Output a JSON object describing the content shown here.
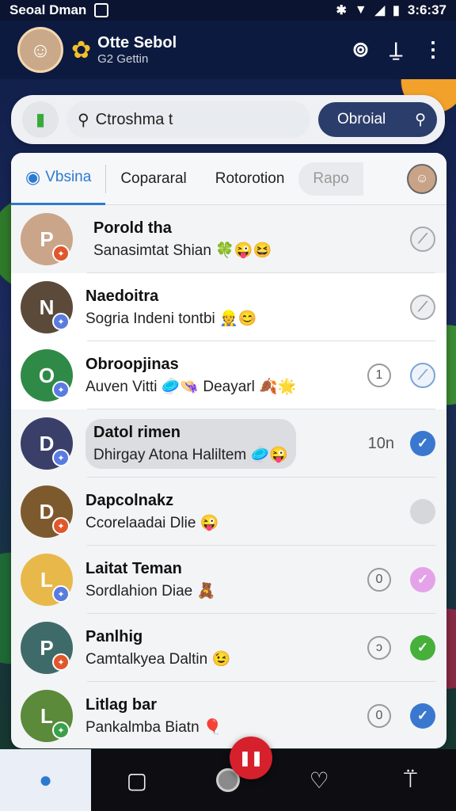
{
  "status_bar": {
    "left_text": "Seoal Dman",
    "time": "3:6:37"
  },
  "app_bar": {
    "title": "Otte Sebol",
    "subtitle": "G2 Gettin",
    "icons": [
      "search-icon",
      "user-pin-icon",
      "more-vert-icon"
    ]
  },
  "search": {
    "value": "Ctroshma t",
    "button_label": "Obroial"
  },
  "tabs": [
    {
      "label": "Vbsina",
      "active": true
    },
    {
      "label": "Copararal",
      "active": false
    },
    {
      "label": "Rotorotion",
      "active": false
    },
    {
      "label": "Rapo",
      "active": false
    }
  ],
  "chats": [
    {
      "name": "Porold tha",
      "message": "Sanasimtat Shian 🍀😜😆",
      "count": "",
      "check_style": "outline",
      "check_glyph": "⟋",
      "badge_color": "#e0572b",
      "avatar_color": "#caa589",
      "initial": "P",
      "pill": true
    },
    {
      "name": "Naedoitra",
      "message": "Sogria Indeni tontbi 👷😊",
      "count": "",
      "check_style": "outline",
      "check_glyph": "⟋",
      "badge_color": "#5a7be0",
      "avatar_color": "#5b4a3a",
      "initial": "N",
      "pill": false,
      "highlight": true
    },
    {
      "name": "Obroopjinas",
      "message": "Auven Vitti 🥏👒 Deayarl 🍂🌟",
      "count": "1",
      "check_style": "outline-blue",
      "check_glyph": "⟋",
      "badge_color": "#5a7be0",
      "avatar_color": "#2f8a47",
      "initial": "O",
      "pill": false,
      "highlight": true
    },
    {
      "name": "Datol rimen",
      "message": "Dhirgay Atona Haliltem 🥏😜",
      "count": "10n",
      "check_style": "blue",
      "check_glyph": "✓",
      "badge_color": "#5a7be0",
      "avatar_color": "#3a3f6a",
      "initial": "D",
      "pill": true,
      "grey_pill": true
    },
    {
      "name": "Dapcolnakz",
      "message": "Ccorelaadai Dlie 😜",
      "count": "",
      "check_style": "grey",
      "check_glyph": "",
      "badge_color": "#e0572b",
      "avatar_color": "#7d5a2e",
      "initial": "D",
      "pill": false
    },
    {
      "name": "Laitat Teman",
      "message": "Sordlahion Diae 🧸",
      "count": "0",
      "check_style": "pink",
      "check_glyph": "✓",
      "badge_color": "#5a7be0",
      "avatar_color": "#e8b84a",
      "initial": "L",
      "pill": false
    },
    {
      "name": "Panlhig",
      "message": "Camtalkyea Daltin 😉",
      "count": "ↄ",
      "check_style": "green",
      "check_glyph": "✓",
      "badge_color": "#e0572b",
      "avatar_color": "#3f6a6a",
      "initial": "P",
      "pill": false
    },
    {
      "name": "Litlag bar",
      "message": "Pankalmba Biatn 🎈",
      "count": "0",
      "check_style": "blue",
      "check_glyph": "✓",
      "badge_color": "#3aa04a",
      "avatar_color": "#5a8a3a",
      "initial": "L",
      "pill": false
    }
  ],
  "nav": [
    "person-icon",
    "square-icon",
    "home-icon",
    "heart-icon",
    "profile-icon"
  ]
}
